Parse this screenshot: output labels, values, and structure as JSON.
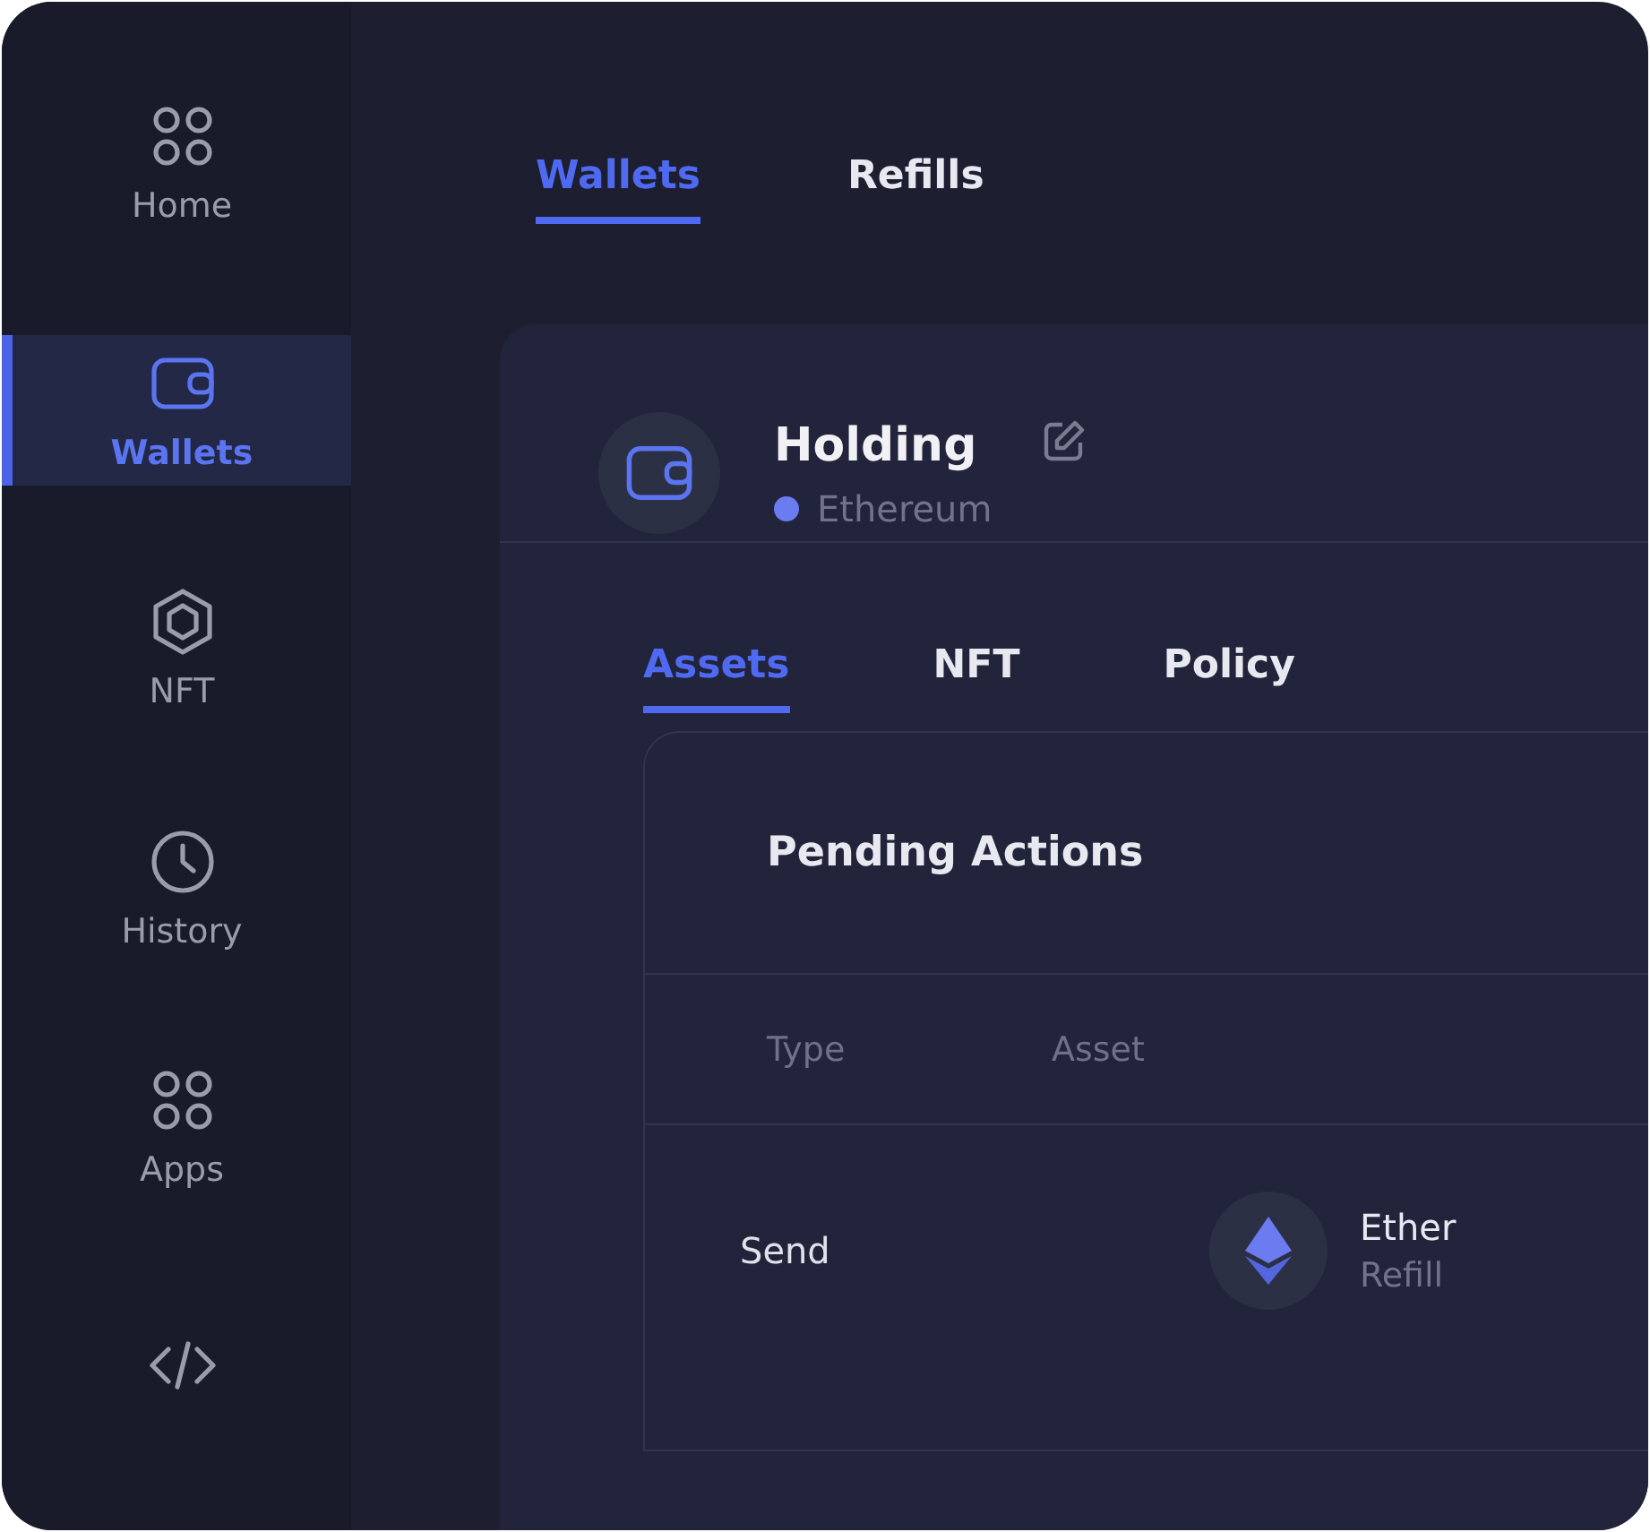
{
  "sidebar": {
    "items": [
      {
        "kind": "home",
        "label": "Home",
        "selected": false
      },
      {
        "kind": "wallet",
        "label": "Wallets",
        "selected": true
      },
      {
        "kind": "nft",
        "label": "NFT",
        "selected": false
      },
      {
        "kind": "history",
        "label": "History",
        "selected": false
      },
      {
        "kind": "apps",
        "label": "Apps",
        "selected": false
      },
      {
        "kind": "code",
        "selected": false
      }
    ]
  },
  "top_tabs": [
    {
      "label": "Wallets",
      "selected": true
    },
    {
      "label": "Refills",
      "selected": false
    }
  ],
  "wallet": {
    "title": "Holding",
    "network": {
      "name": "Ethereum",
      "color": "#6b7cf0"
    }
  },
  "tabs": [
    {
      "label": "Assets",
      "selected": true
    },
    {
      "label": "NFT",
      "selected": false
    },
    {
      "label": "Policy",
      "selected": false
    }
  ],
  "pending": {
    "title": "Pending Actions",
    "columns": [
      "Type",
      "Asset"
    ],
    "rows": [
      {
        "type": "Send",
        "asset": "Ether",
        "asset_note": "Refill"
      }
    ]
  }
}
